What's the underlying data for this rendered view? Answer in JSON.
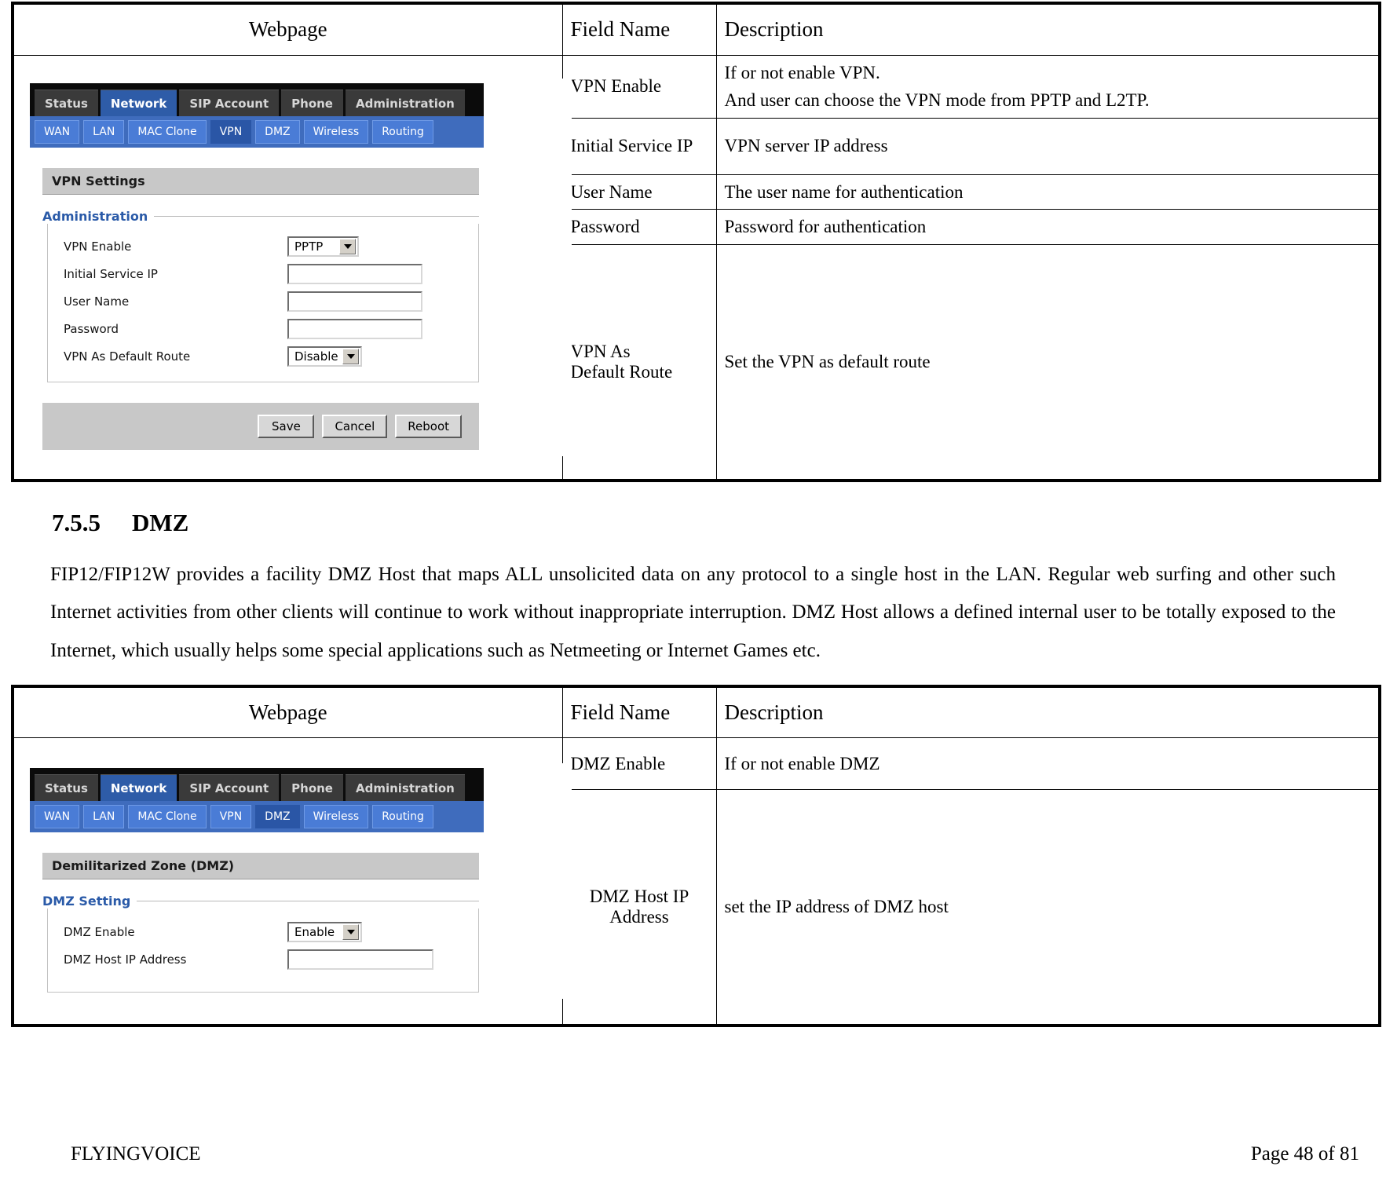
{
  "table_headers": {
    "webpage": "Webpage",
    "field_name": "Field Name",
    "description": "Description"
  },
  "router_ui": {
    "main_tabs": [
      {
        "label": "Status",
        "active": false
      },
      {
        "label": "Network",
        "active": true
      },
      {
        "label": "SIP Account",
        "active": false
      },
      {
        "label": "Phone",
        "active": false
      },
      {
        "label": "Administration",
        "active": false
      }
    ],
    "vpn_sub_tabs": [
      {
        "label": "WAN",
        "active": false
      },
      {
        "label": "LAN",
        "active": false
      },
      {
        "label": "MAC Clone",
        "active": false
      },
      {
        "label": "VPN",
        "active": true
      },
      {
        "label": "DMZ",
        "active": false
      },
      {
        "label": "Wireless",
        "active": false
      },
      {
        "label": "Routing",
        "active": false
      }
    ],
    "dmz_sub_tabs": [
      {
        "label": "WAN",
        "active": false
      },
      {
        "label": "LAN",
        "active": false
      },
      {
        "label": "MAC Clone",
        "active": false
      },
      {
        "label": "VPN",
        "active": false
      },
      {
        "label": "DMZ",
        "active": true
      },
      {
        "label": "Wireless",
        "active": false
      },
      {
        "label": "Routing",
        "active": false
      }
    ],
    "vpn_page": {
      "panel_title": "VPN Settings",
      "legend": "Administration",
      "fields": {
        "vpn_enable_label": "VPN Enable",
        "vpn_enable_value": "PPTP",
        "initial_service_ip_label": "Initial Service IP",
        "initial_service_ip_value": "",
        "user_name_label": "User Name",
        "user_name_value": "",
        "password_label": "Password",
        "password_value": "",
        "vpn_default_route_label": "VPN As Default Route",
        "vpn_default_route_value": "Disable"
      },
      "buttons": {
        "save": "Save",
        "cancel": "Cancel",
        "reboot": "Reboot"
      }
    },
    "dmz_page": {
      "panel_title": "Demilitarized Zone (DMZ)",
      "legend": "DMZ Setting",
      "fields": {
        "dmz_enable_label": "DMZ Enable",
        "dmz_enable_value": "Enable",
        "dmz_host_ip_label": "DMZ Host IP Address",
        "dmz_host_ip_value": ""
      }
    }
  },
  "vpn_table_rows": [
    {
      "field": "VPN Enable",
      "desc_line1": "If or not enable VPN.",
      "desc_line2": "And user can choose the VPN mode from PPTP and L2TP."
    },
    {
      "field": "Initial Service IP",
      "desc_line1": "VPN server IP address",
      "desc_line2": ""
    },
    {
      "field": "User Name",
      "desc_line1": "The user name for authentication",
      "desc_line2": ""
    },
    {
      "field": "Password",
      "desc_line1": "Password for authentication",
      "desc_line2": ""
    },
    {
      "field": "VPN As Default Route",
      "desc_line1": "Set the VPN as default route",
      "desc_line2": ""
    }
  ],
  "dmz_table_rows": [
    {
      "field": "DMZ Enable",
      "desc_line1": "If or not enable DMZ"
    },
    {
      "field": "DMZ Host IP Address",
      "desc_line1": "set the IP address of DMZ host"
    }
  ],
  "section": {
    "number": "7.5.5",
    "title": "DMZ",
    "paragraph": "FIP12/FIP12W provides a facility DMZ Host that maps ALL unsolicited data on any protocol to a single host in the LAN. Regular web surfing and other such Internet activities from other clients will continue to work without inappropriate interruption. DMZ Host allows a defined internal user to be totally exposed to the Internet, which usually helps some special applications such as Netmeeting or Internet Games etc."
  },
  "footer": {
    "company": "FLYINGVOICE",
    "page": "Page  48  of  81"
  }
}
